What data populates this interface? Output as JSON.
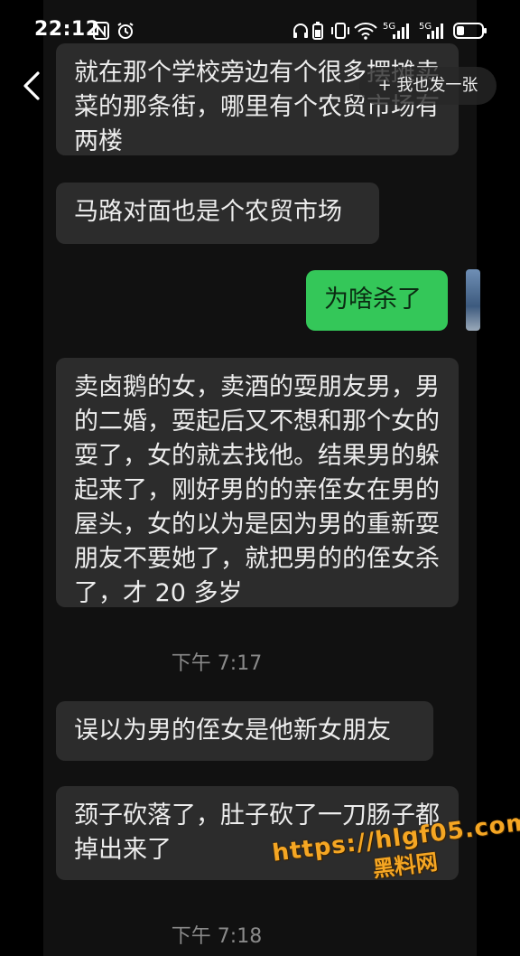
{
  "status_bar": {
    "time": "22:12",
    "network": "5G"
  },
  "header": {
    "share_button_label": "+ 我也发一张"
  },
  "messages": [
    {
      "side": "received",
      "text": "就在那个学校旁边有个很多摆摊卖菜的那条街，哪里有个农贸市场有两楼"
    },
    {
      "side": "received",
      "text": "马路对面也是个农贸市场"
    },
    {
      "side": "sent",
      "text": "为啥杀了"
    },
    {
      "side": "received",
      "text": "卖卤鹅的女，卖酒的耍朋友男，男的二婚，耍起后又不想和那个女的耍了，女的就去找他。结果男的躲起来了，刚好男的的亲侄女在男的屋头，女的以为是因为男的重新耍朋友不要她了，就把男的的侄女杀了，才 20 多岁"
    },
    {
      "side": "received",
      "text": "误以为男的侄女是他新女朋友"
    },
    {
      "side": "received",
      "text": "颈子砍落了，肚子砍了一刀肠子都掉出来了"
    }
  ],
  "timestamps": [
    "下午 7:17",
    "下午 7:18"
  ],
  "watermark": {
    "url": "https://hlgf05.com",
    "name": "黑料网"
  },
  "colors": {
    "background": "#111111",
    "received_bubble": "#2c2c2c",
    "sent_bubble": "#34c759",
    "watermark": "#f5a623"
  }
}
